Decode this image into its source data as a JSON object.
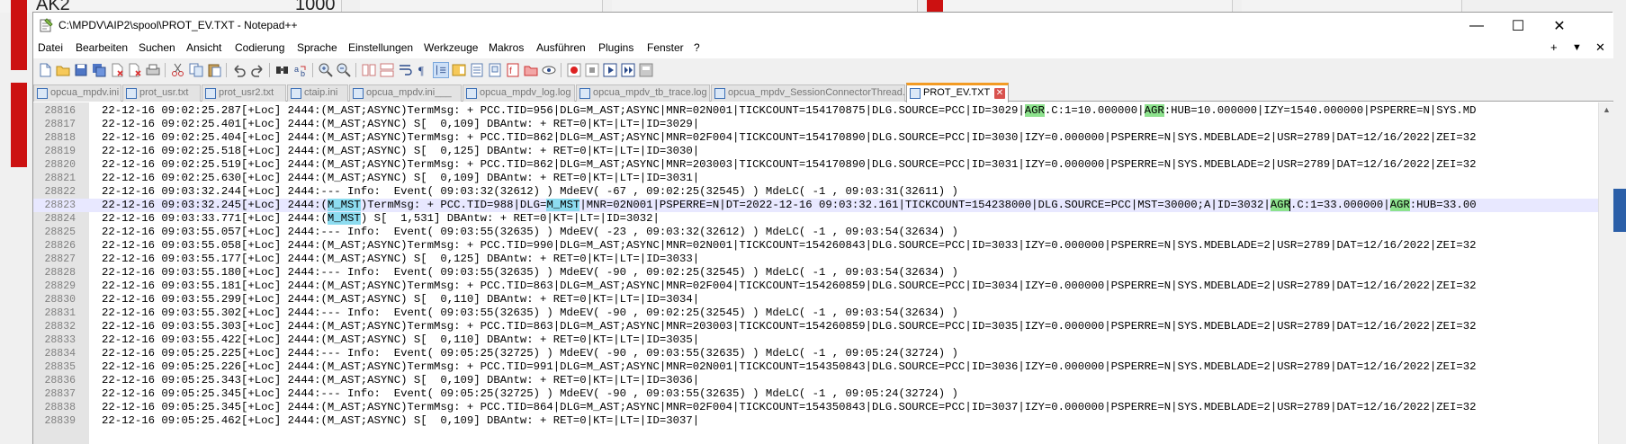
{
  "background": {
    "ak2_label": "AK2",
    "ak2_value": "1000"
  },
  "window": {
    "title": "C:\\MPDV\\AIP2\\spool\\PROT_EV.TXT - Notepad++",
    "minimize_glyph": "—",
    "maximize_glyph": "☐",
    "close_glyph": "✕"
  },
  "menu": {
    "items": [
      "Datei",
      "Bearbeiten",
      "Suchen",
      "Ansicht",
      "Codierung",
      "Sprache",
      "Einstellungen",
      "Werkzeuge",
      "Makros",
      "Ausführen",
      "Plugins",
      "Fenster",
      "?"
    ],
    "plus": "+",
    "dropdown": "▼",
    "close": "✕"
  },
  "toolbar": {
    "icons": [
      "new-file-icon",
      "open-file-icon",
      "save-icon",
      "save-all-icon",
      "close-icon",
      "close-all-icon",
      "print-icon",
      "cut-icon",
      "copy-icon",
      "paste-icon",
      "undo-icon",
      "redo-icon",
      "find-icon",
      "replace-icon",
      "zoom-in-icon",
      "zoom-out-icon",
      "sync-vertical-icon",
      "sync-horizontal-icon",
      "word-wrap-icon",
      "show-all-chars-icon",
      "indent-guide-icon",
      "document-map-icon",
      "function-list-icon",
      "folder-workspace-icon",
      "monitoring-icon",
      "record-macro-icon",
      "stop-macro-icon",
      "play-macro-icon",
      "run-macro-multiple-icon",
      "save-macro-icon"
    ]
  },
  "tabs": [
    {
      "label": "opcua_mpdv.ini",
      "active": false
    },
    {
      "label": "prot_usr.txt",
      "active": false
    },
    {
      "label": "prot_usr2.txt",
      "active": false
    },
    {
      "label": "ctaip.ini",
      "active": false
    },
    {
      "label": "opcua_mpdv.ini___",
      "active": false
    },
    {
      "label": "opcua_mpdv_log.log",
      "active": false
    },
    {
      "label": "opcua_mpdv_tb_trace.log",
      "active": false
    },
    {
      "label": "opcua_mpdv_SessionConnectorThread.log",
      "active": false
    },
    {
      "label": "PROT_EV.TXT",
      "active": true
    }
  ],
  "colors": {
    "accent_tab": "#f39b23",
    "highlight_green": "#8de28d",
    "highlight_cyan": "#8ddcf0",
    "current_line": "#e8e8ff"
  },
  "editor": {
    "lines": [
      {
        "num": "28816",
        "text": "22-12-16 09:02:25.287[+Loc] 2444:(M_AST;ASYNC)TermMsg: + PCC.TID=956|DLG=M_AST;ASYNC|MNR=02N001|TICKCOUNT=154170875|DLG.SOURCE=PCC|ID=3029|AGR.C:1=10.000000|AGR:HUB=10.000000|IZY=1540.000000|PSPERRE=N|SYS.MD"
      },
      {
        "num": "28817",
        "text": "22-12-16 09:02:25.401[+Loc] 2444:(M_AST;ASYNC) S[  0,109] DBAntw: + RET=0|KT=|LT=|ID=3029|"
      },
      {
        "num": "28818",
        "text": "22-12-16 09:02:25.404[+Loc] 2444:(M_AST;ASYNC)TermMsg: + PCC.TID=862|DLG=M_AST;ASYNC|MNR=02F004|TICKCOUNT=154170890|DLG.SOURCE=PCC|ID=3030|IZY=0.000000|PSPERRE=N|SYS.MDEBLADE=2|USR=2789|DAT=12/16/2022|ZEI=32"
      },
      {
        "num": "28819",
        "text": "22-12-16 09:02:25.518[+Loc] 2444:(M_AST;ASYNC) S[  0,125] DBAntw: + RET=0|KT=|LT=|ID=3030|"
      },
      {
        "num": "28820",
        "text": "22-12-16 09:02:25.519[+Loc] 2444:(M_AST;ASYNC)TermMsg: + PCC.TID=862|DLG=M_AST;ASYNC|MNR=203003|TICKCOUNT=154170890|DLG.SOURCE=PCC|ID=3031|IZY=0.000000|PSPERRE=N|SYS.MDEBLADE=2|USR=2789|DAT=12/16/2022|ZEI=32"
      },
      {
        "num": "28821",
        "text": "22-12-16 09:02:25.630[+Loc] 2444:(M_AST;ASYNC) S[  0,109] DBAntw: + RET=0|KT=|LT=|ID=3031|"
      },
      {
        "num": "28822",
        "text": "22-12-16 09:03:32.244[+Loc] 2444:--- Info:  Event( 09:03:32(32612) ) MdeEV( -67 , 09:02:25(32545) ) MdeLC( -1 , 09:03:31(32611) )"
      },
      {
        "num": "28823",
        "text": "22-12-16 09:03:32.245[+Loc] 2444:(M_MST)TermMsg: + PCC.TID=988|DLG=M_MST|MNR=02N001|PSPERRE=N|DT=2022-12-16 09:03:32.161|TICKCOUNT=154238000|DLG.SOURCE=PCC|MST=30000;A|ID=3032|AGR.C:1=33.000000|AGR:HUB=33.00"
      },
      {
        "num": "28824",
        "text": "22-12-16 09:03:33.771[+Loc] 2444:(M_MST) S[  1,531] DBAntw: + RET=0|KT=|LT=|ID=3032|"
      },
      {
        "num": "28825",
        "text": "22-12-16 09:03:55.057[+Loc] 2444:--- Info:  Event( 09:03:55(32635) ) MdeEV( -23 , 09:03:32(32612) ) MdeLC( -1 , 09:03:54(32634) )"
      },
      {
        "num": "28826",
        "text": "22-12-16 09:03:55.058[+Loc] 2444:(M_AST;ASYNC)TermMsg: + PCC.TID=990|DLG=M_AST;ASYNC|MNR=02N001|TICKCOUNT=154260843|DLG.SOURCE=PCC|ID=3033|IZY=0.000000|PSPERRE=N|SYS.MDEBLADE=2|USR=2789|DAT=12/16/2022|ZEI=32"
      },
      {
        "num": "28827",
        "text": "22-12-16 09:03:55.177[+Loc] 2444:(M_AST;ASYNC) S[  0,125] DBAntw: + RET=0|KT=|LT=|ID=3033|"
      },
      {
        "num": "28828",
        "text": "22-12-16 09:03:55.180[+Loc] 2444:--- Info:  Event( 09:03:55(32635) ) MdeEV( -90 , 09:02:25(32545) ) MdeLC( -1 , 09:03:54(32634) )"
      },
      {
        "num": "28829",
        "text": "22-12-16 09:03:55.181[+Loc] 2444:(M_AST;ASYNC)TermMsg: + PCC.TID=863|DLG=M_AST;ASYNC|MNR=02F004|TICKCOUNT=154260859|DLG.SOURCE=PCC|ID=3034|IZY=0.000000|PSPERRE=N|SYS.MDEBLADE=2|USR=2789|DAT=12/16/2022|ZEI=32"
      },
      {
        "num": "28830",
        "text": "22-12-16 09:03:55.299[+Loc] 2444:(M_AST;ASYNC) S[  0,110] DBAntw: + RET=0|KT=|LT=|ID=3034|"
      },
      {
        "num": "28831",
        "text": "22-12-16 09:03:55.302[+Loc] 2444:--- Info:  Event( 09:03:55(32635) ) MdeEV( -90 , 09:02:25(32545) ) MdeLC( -1 , 09:03:54(32634) )"
      },
      {
        "num": "28832",
        "text": "22-12-16 09:03:55.303[+Loc] 2444:(M_AST;ASYNC)TermMsg: + PCC.TID=863|DLG=M_AST;ASYNC|MNR=203003|TICKCOUNT=154260859|DLG.SOURCE=PCC|ID=3035|IZY=0.000000|PSPERRE=N|SYS.MDEBLADE=2|USR=2789|DAT=12/16/2022|ZEI=32"
      },
      {
        "num": "28833",
        "text": "22-12-16 09:03:55.422[+Loc] 2444:(M_AST;ASYNC) S[  0,110] DBAntw: + RET=0|KT=|LT=|ID=3035|"
      },
      {
        "num": "28834",
        "text": "22-12-16 09:05:25.225[+Loc] 2444:--- Info:  Event( 09:05:25(32725) ) MdeEV( -90 , 09:03:55(32635) ) MdeLC( -1 , 09:05:24(32724) )"
      },
      {
        "num": "28835",
        "text": "22-12-16 09:05:25.226[+Loc] 2444:(M_AST;ASYNC)TermMsg: + PCC.TID=991|DLG=M_AST;ASYNC|MNR=02N001|TICKCOUNT=154350843|DLG.SOURCE=PCC|ID=3036|IZY=0.000000|PSPERRE=N|SYS.MDEBLADE=2|USR=2789|DAT=12/16/2022|ZEI=32"
      },
      {
        "num": "28836",
        "text": "22-12-16 09:05:25.343[+Loc] 2444:(M_AST;ASYNC) S[  0,109] DBAntw: + RET=0|KT=|LT=|ID=3036|"
      },
      {
        "num": "28837",
        "text": "22-12-16 09:05:25.345[+Loc] 2444:--- Info:  Event( 09:05:25(32725) ) MdeEV( -90 , 09:03:55(32635) ) MdeLC( -1 , 09:05:24(32724) )"
      },
      {
        "num": "28838",
        "text": "22-12-16 09:05:25.345[+Loc] 2444:(M_AST;ASYNC)TermMsg: + PCC.TID=864|DLG=M_AST;ASYNC|MNR=02F004|TICKCOUNT=154350843|DLG.SOURCE=PCC|ID=3037|IZY=0.000000|PSPERRE=N|SYS.MDEBLADE=2|USR=2789|DAT=12/16/2022|ZEI=32"
      },
      {
        "num": "28839",
        "text": "22-12-16 09:05:25.462[+Loc] 2444:(M_AST;ASYNC) S[  0,109] DBAntw: + RET=0|KT=|LT=|ID=3037|"
      }
    ],
    "current_line": "28823",
    "highlight_terms": [
      "AGR",
      "M_MST"
    ]
  }
}
